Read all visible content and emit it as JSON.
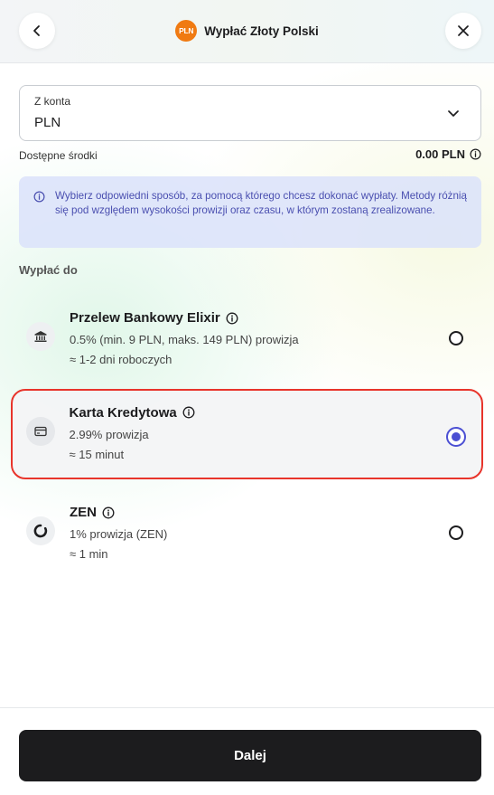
{
  "header": {
    "currency_badge": "PLN",
    "title": "Wypłać Złoty Polski"
  },
  "account": {
    "label": "Z konta",
    "value": "PLN"
  },
  "available": {
    "label": "Dostępne środki",
    "value": "0.00 PLN"
  },
  "notice": {
    "text": "Wybierz odpowiedni sposób, za pomocą którego chcesz dokonać wypłaty. Metody różnią się pod względem wysokości prowizji oraz czasu, w którym zostaną zrealizowane."
  },
  "section_label": "Wypłać do",
  "methods": [
    {
      "title": "Przelew Bankowy Elixir",
      "fee": "0.5% (min. 9 PLN, maks. 149 PLN) prowizja",
      "time": "≈ 1-2 dni roboczych",
      "icon": "bank-icon",
      "selected": false
    },
    {
      "title": "Karta Kredytowa",
      "fee": "2.99% prowizja",
      "time": "≈ 15 minut",
      "icon": "credit-card-icon",
      "selected": true
    },
    {
      "title": "ZEN",
      "fee": "1% prowizja (ZEN)",
      "time": "≈ 1 min",
      "icon": "zen-logo-icon",
      "selected": false
    }
  ],
  "footer": {
    "continue_label": "Dalej"
  },
  "colors": {
    "accent": "#4b4fd3",
    "selection_outline": "#e8342b",
    "currency_badge": "#f07a12",
    "notice_background": "#dae2fa",
    "primary_button": "#1c1c1e"
  }
}
